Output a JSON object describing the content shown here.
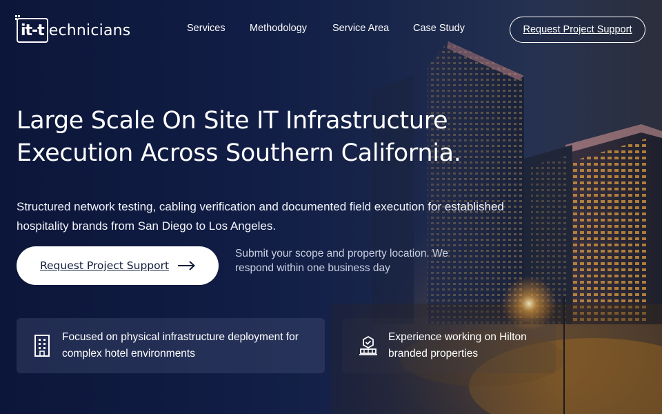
{
  "brand": {
    "logo_mark": "it-t",
    "logo_text": "echnicians"
  },
  "nav": {
    "items": [
      "Services",
      "Methodology",
      "Service Area",
      "Case Study"
    ],
    "cta_label": "Request Project Support"
  },
  "hero": {
    "title_line1": "Large Scale On Site IT Infrastructure",
    "title_line2": "Execution Across Southern California.",
    "subtitle": "Structured network testing, cabling verification and documented field execution for established hospitality brands from San Diego to Los Angeles.",
    "cta_label": "Request Project Support",
    "cta_icon": "arrow-right-icon",
    "note": "Submit your scope and property location. We respond within one business day"
  },
  "features": [
    {
      "icon": "building-icon",
      "text": "Focused on physical infrastructure deployment for complex hotel environments"
    },
    {
      "icon": "hotel-badge-icon",
      "text": "Experience working on Hilton branded properties"
    }
  ],
  "colors": {
    "background": "#0f1a3a",
    "text": "#ffffff",
    "muted_text": "#c9cfe0",
    "button_bg": "#ffffff",
    "button_text": "#0f1a3a",
    "city_glow": "#ffaa3c"
  }
}
